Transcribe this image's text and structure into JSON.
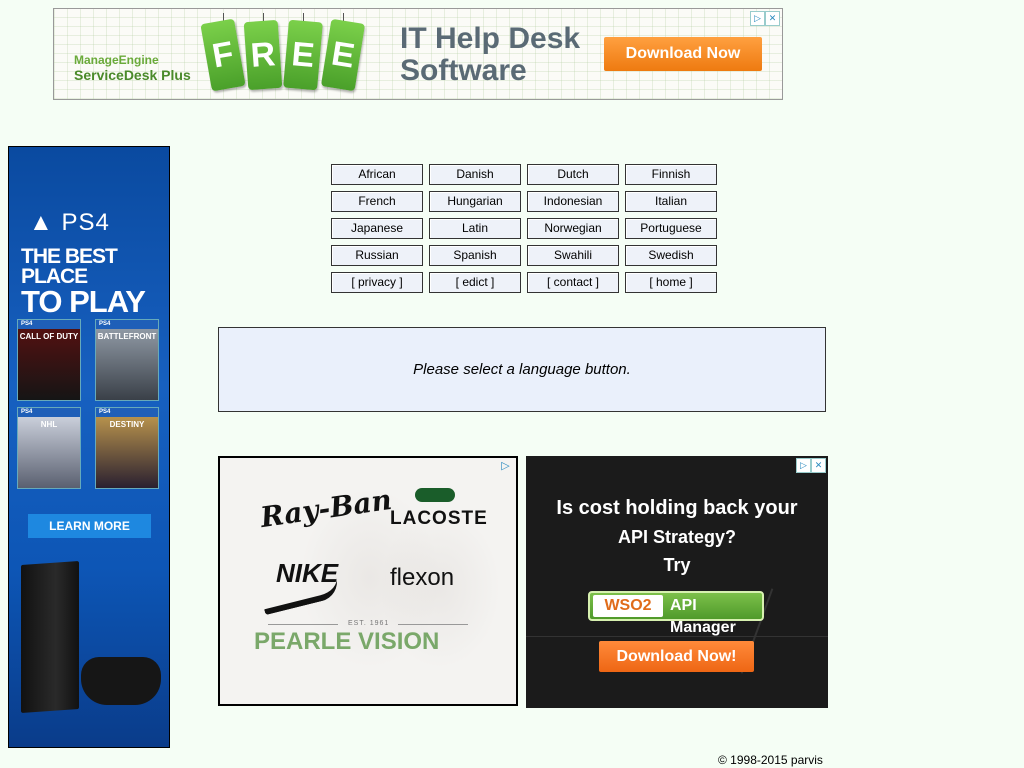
{
  "top_ad": {
    "brand": "ManageEngine",
    "product": "ServiceDesk Plus",
    "free_letters": [
      "F",
      "R",
      "E",
      "E"
    ],
    "headline_line1": "IT Help Desk",
    "headline_line2": "Software",
    "cta": "Download Now",
    "adchoices_icon": "▷",
    "close_icon": "✕"
  },
  "ps4_ad": {
    "logo": "PS4",
    "tagline_line1": "THE BEST PLACE",
    "tagline_line2": "TO PLAY",
    "games": [
      "CALL OF DUTY",
      "BATTLEFRONT",
      "NHL",
      "DESTINY"
    ],
    "game_badge": "PS4",
    "cta": "LEARN MORE"
  },
  "language_buttons": [
    [
      "African",
      "Danish",
      "Dutch",
      "Finnish"
    ],
    [
      "French",
      "Hungarian",
      "Indonesian",
      "Italian"
    ],
    [
      "Japanese",
      "Latin",
      "Norwegian",
      "Portuguese"
    ],
    [
      "Russian",
      "Spanish",
      "Swahili",
      "Swedish"
    ],
    [
      "[ privacy ]",
      "[ edict ]",
      "[ contact ]",
      "[ home ]"
    ]
  ],
  "message": "Please select a language button.",
  "pearle_ad": {
    "brand_rayban": "Ray-Ban",
    "brand_lacoste": "LACOSTE",
    "brand_nike": "NIKE",
    "brand_flexon": "flexon",
    "est": "EST. 1961",
    "pearle": "PEARLE VISION",
    "adchoices_icon": "▷"
  },
  "wso2_ad": {
    "line1": "Is cost holding back your",
    "line2": "API Strategy?",
    "line3": "Try",
    "logo": "WSO2",
    "product": "API Manager",
    "cta": "Download Now!",
    "adchoices_icon": "▷",
    "close_icon": "✕"
  },
  "footer": {
    "copyright": "© 1998-2015 parvis"
  }
}
